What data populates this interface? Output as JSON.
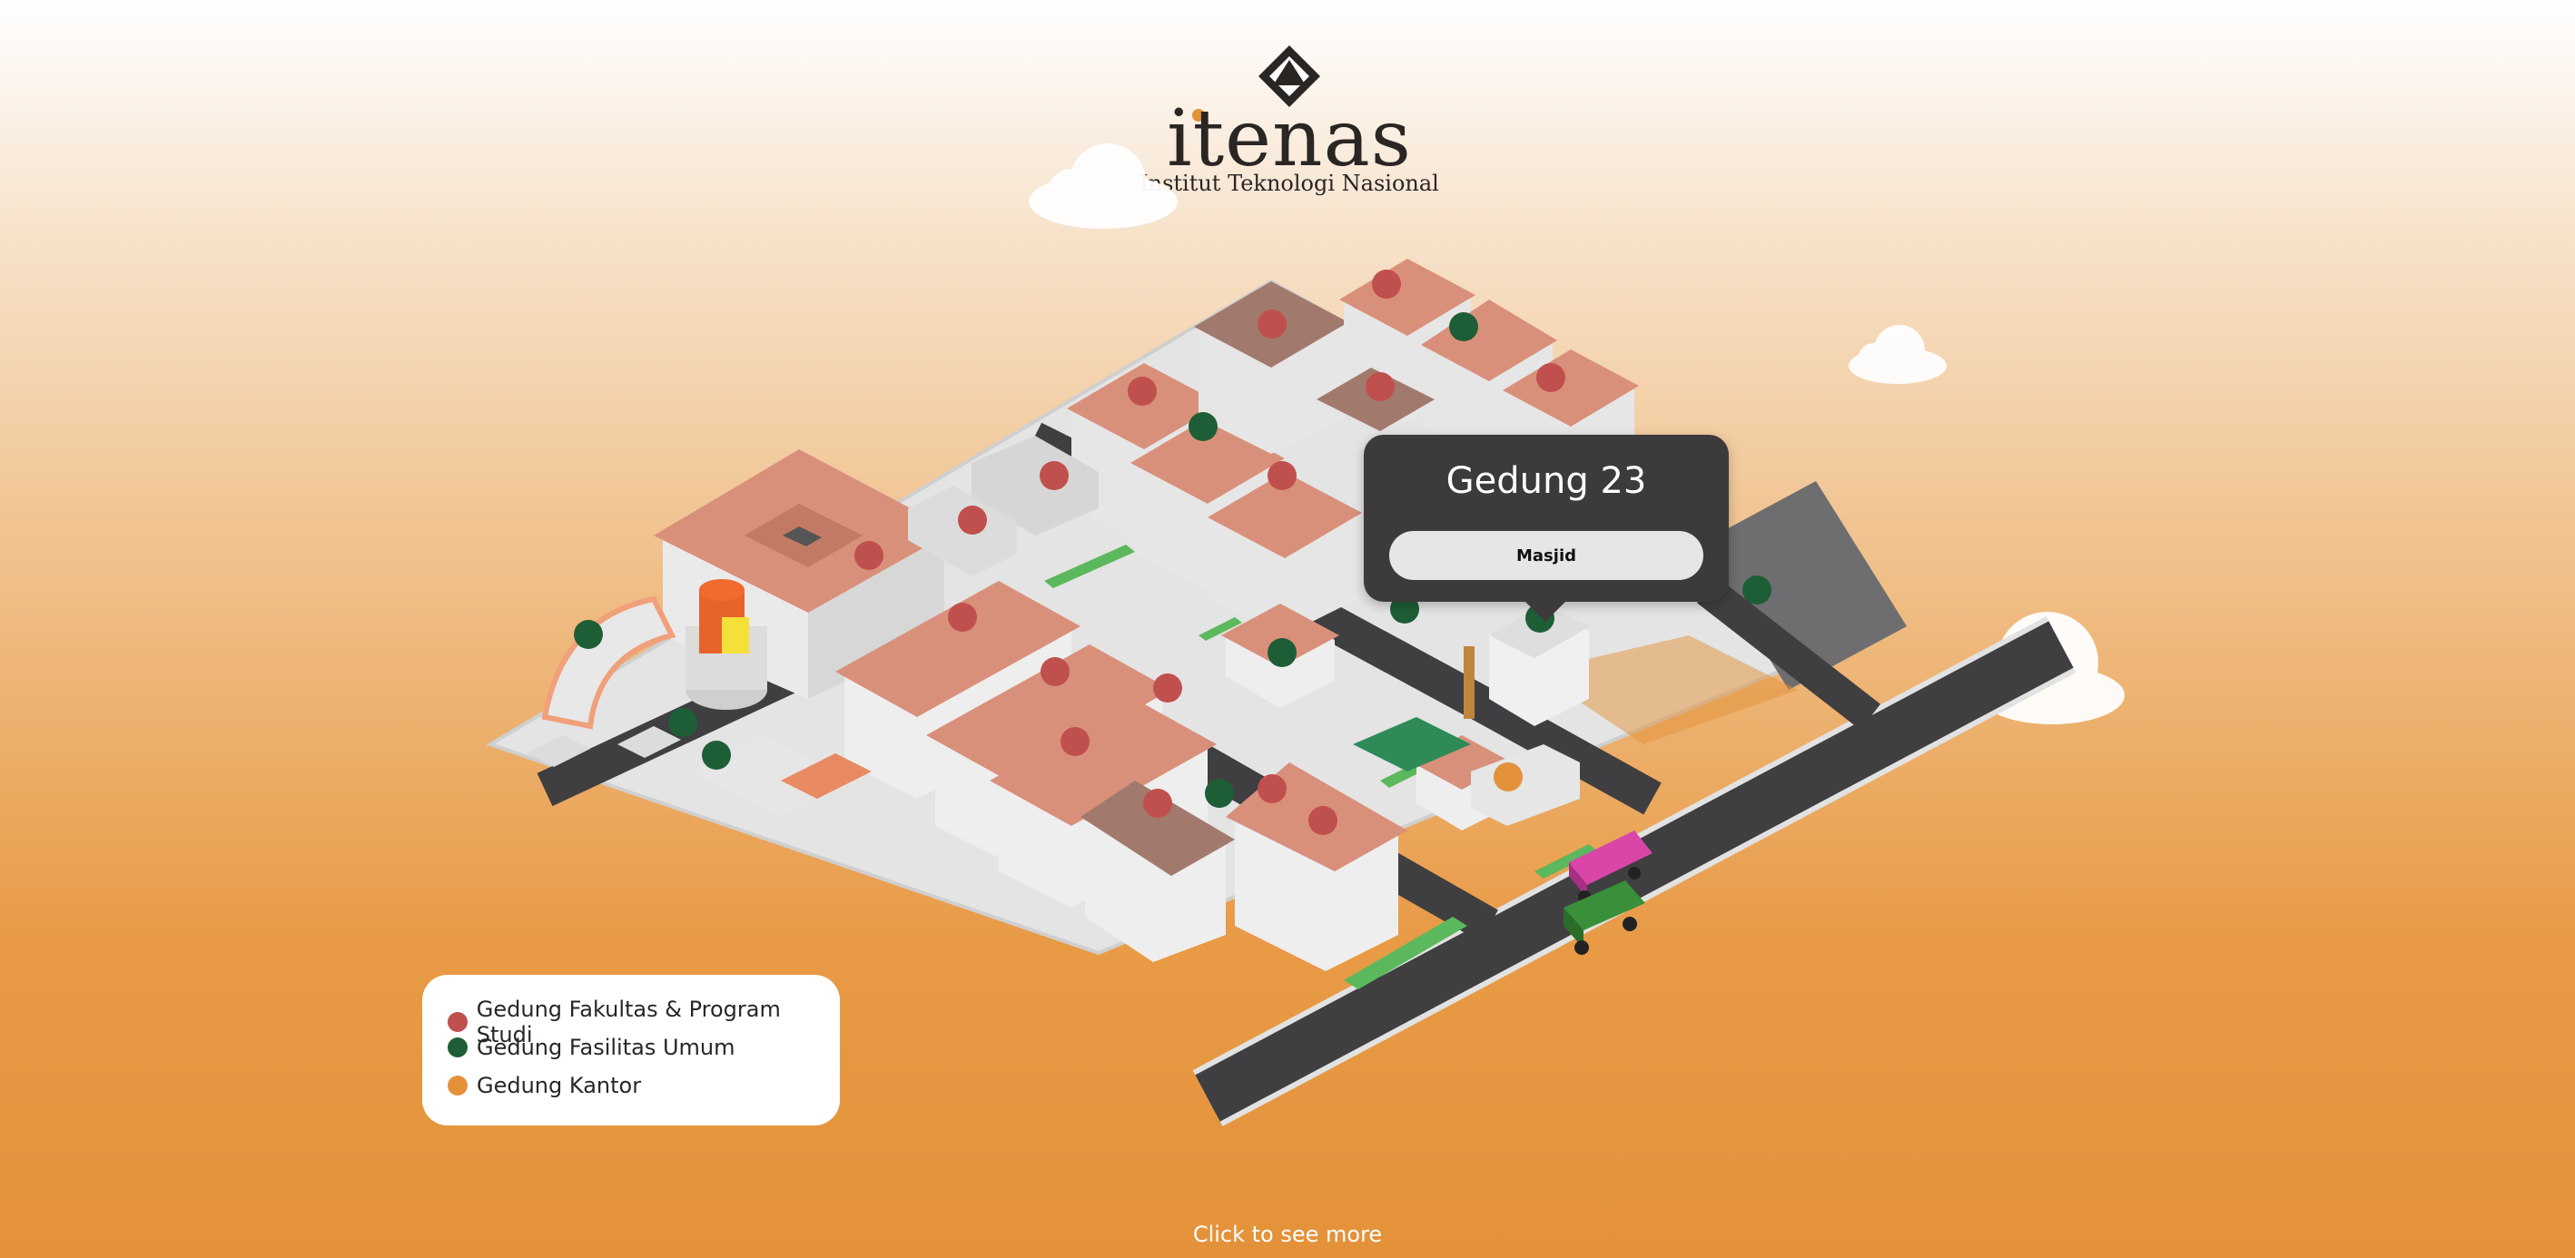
{
  "header": {
    "logo_word": "itenas",
    "logo_subtitle": "Institut Teknologi Nasional",
    "logo_icon": "itenas-logo-icon"
  },
  "tooltip": {
    "title": "Gedung 23",
    "button_label": "Masjid"
  },
  "legend": {
    "items": [
      {
        "label": "Gedung Fakultas & Program Studi",
        "color": "#c0504d"
      },
      {
        "label": "Gedung Fasilitas Umum",
        "color": "#1e5e36"
      },
      {
        "label": "Gedung Kantor",
        "color": "#e3923a"
      }
    ]
  },
  "footer": {
    "cta": "Click to see more"
  },
  "colors": {
    "faculty": "#c0504d",
    "public_facility": "#1e5e36",
    "office": "#e3923a",
    "road": "#3f3e40",
    "ground": "#e2e2e2",
    "roof": "#d9907a"
  }
}
